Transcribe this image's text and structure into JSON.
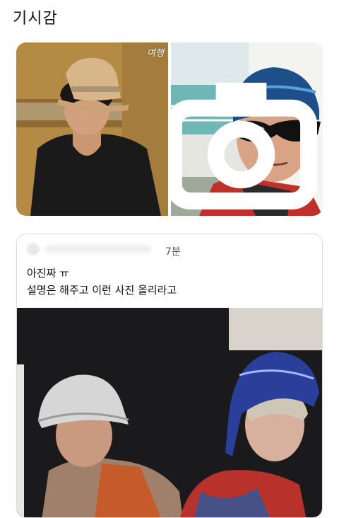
{
  "post": {
    "title": "기시감"
  },
  "left_photo": {
    "watermark": "여행",
    "alt": "photo"
  },
  "right_photo": {
    "icon": "camera-icon"
  },
  "quote": {
    "time": "7분",
    "lines": [
      "아진짜 ㅠ",
      "설명은 해주고 이런 사진 올리라고"
    ]
  }
}
